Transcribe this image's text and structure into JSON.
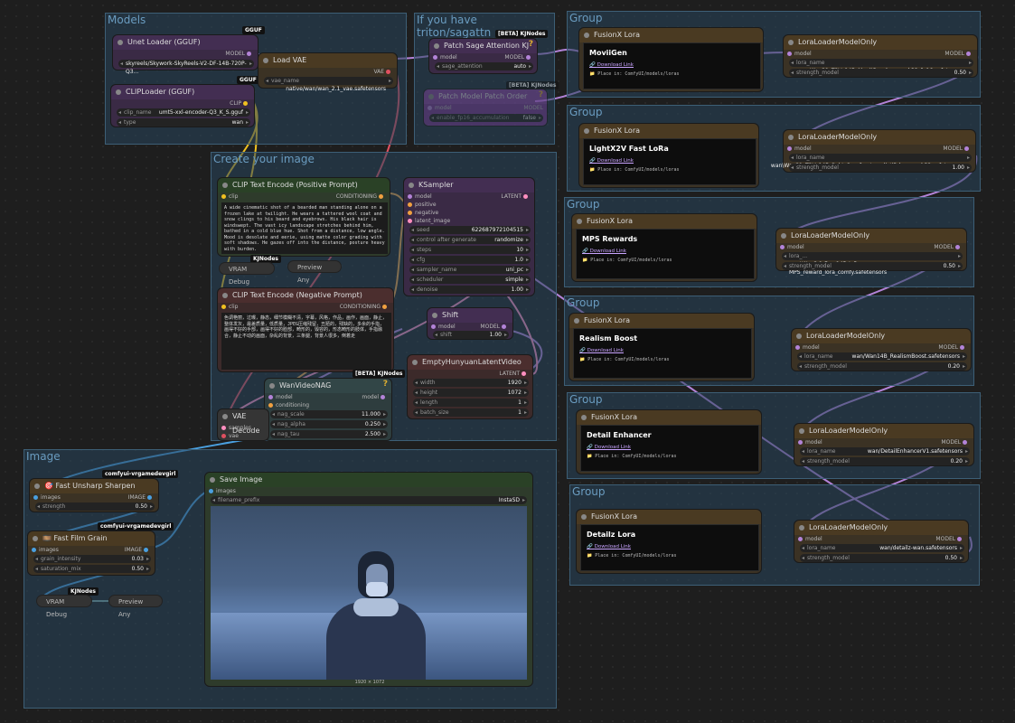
{
  "groups": {
    "models": "Models",
    "triton": "If you have triton/sagattn",
    "create": "Create your image",
    "image": "Image",
    "lora_groups": [
      "Group",
      "Group",
      "Group",
      "Group",
      "Group",
      "Group"
    ]
  },
  "tags": {
    "gguf": "GGUF",
    "kjnodes_beta": "[BETA] KJNodes",
    "kjnodes": "KJNodes",
    "author": "comfyui-vrgamedevgirl"
  },
  "unet_loader": {
    "title": "Unet Loader (GGUF)",
    "out": "MODEL",
    "value": "skyreels/Skywork-SkyReels-V2-DF-14B-720P-Q3..."
  },
  "clip_loader": {
    "title": "CLIPLoader (GGUF)",
    "out": "CLIP",
    "clip_name_label": "clip_name",
    "clip_name": "umt5-xxl-encoder-Q3_K_S.gguf",
    "type_label": "type",
    "type": "wan"
  },
  "load_vae": {
    "title": "Load VAE",
    "out": "VAE",
    "label": "vae_name",
    "value": "native/wan/wan_2.1_vae.safetensors"
  },
  "patch_sage": {
    "title": "Patch Sage Attention KJ",
    "in": "model",
    "out": "MODEL",
    "label": "sage_attention",
    "value": "auto"
  },
  "patch_fast": {
    "title": "Patch Model Patch Order",
    "in": "model",
    "out": "MODEL",
    "label": "enable_fp16_accumulation",
    "value": "false"
  },
  "clip_pos": {
    "title": "CLIP Text Encode (Positive Prompt)",
    "in": "clip",
    "out": "CONDITIONING",
    "text": "A wide cinematic shot of a bearded man standing alone on a frozen lake at twilight. He wears a tattered wool coat and snow clings to his beard and eyebrows. His black hair is windswept. The vast icy landscape stretches behind him, bathed in a cold blue hue. Shot from a distance, low angle. Mood is desolate and eerie, using matte color grading with soft shadows. He gazes off into the distance, posture heavy with burden."
  },
  "clip_neg": {
    "title": "CLIP Text Encode (Negative Prompt)",
    "in": "clip",
    "out": "CONDITIONING",
    "text": "色调艳丽，过曝，静态，细节模糊不清，字幕，风格，作品，画作，画面，静止，整体发灰，最差质量，低质量，JPEG压缩残留，丑陋的，残缺的，多余的手指，画得不好的手部，画得不好的脸部，畸形的，毁容的，形态畸形的肢体，手指融合，静止不动的画面，杂乱的背景，三条腿，背景人很多，倒着走"
  },
  "vram1": {
    "title": "VRAM Debug"
  },
  "preview1": {
    "title": "Preview Any"
  },
  "ksampler": {
    "title": "KSampler",
    "inputs": [
      "model",
      "positive",
      "negative",
      "latent_image"
    ],
    "out": "LATENT",
    "widgets": [
      [
        "seed",
        "622687972104515"
      ],
      [
        "control after generate",
        "randomize"
      ],
      [
        "steps",
        "10"
      ],
      [
        "cfg",
        "1.0"
      ],
      [
        "sampler_name",
        "uni_pc"
      ],
      [
        "scheduler",
        "simple"
      ],
      [
        "denoise",
        "1.00"
      ]
    ]
  },
  "shift": {
    "title": "Shift",
    "in": "model",
    "out": "MODEL",
    "label": "shift",
    "value": "1.00"
  },
  "empty_latent": {
    "title": "EmptyHunyuanLatentVideo",
    "out": "LATENT",
    "widgets": [
      [
        "width",
        "1920"
      ],
      [
        "height",
        "1072"
      ],
      [
        "length",
        "1"
      ],
      [
        "batch_size",
        "1"
      ]
    ]
  },
  "wan_nag": {
    "title": "WanVideoNAG",
    "inputs": [
      "model",
      "conditioning"
    ],
    "out": "model",
    "widgets": [
      [
        "nag_scale",
        "11.000"
      ],
      [
        "nag_alpha",
        "0.250"
      ],
      [
        "nag_tau",
        "2.500"
      ]
    ]
  },
  "vae_decode": {
    "title": "VAE Decode",
    "inputs": [
      "samples",
      "vae"
    ]
  },
  "unsharp": {
    "title": "🎯 Fast Unsharp Sharpen",
    "in": "images",
    "out": "IMAGE",
    "label": "strength",
    "value": "0.50"
  },
  "film_grain": {
    "title": "🎞️ Fast Film Grain",
    "in": "images",
    "out": "IMAGE",
    "widgets": [
      [
        "grain_intensity",
        "0.03"
      ],
      [
        "saturation_mix",
        "0.50"
      ]
    ]
  },
  "vram2": {
    "title": "VRAM Debug"
  },
  "preview2": {
    "title": "Preview Any"
  },
  "save_image": {
    "title": "Save Image",
    "in": "images",
    "label": "filename_prefix",
    "value": "InstaSD",
    "size": "1920 × 1072"
  },
  "loras": [
    {
      "note_head": "FusionX Lora",
      "note_title": "MoviiGen",
      "link": "Download Link",
      "path": "Place in: ComfyUI/models/loras",
      "loader": "LoraLoaderModelOnly",
      "lora_label": "lora_name",
      "lora_name": "Wan21_T2V_14B_MoviiGen_lora_rank32_fp16.safetensors",
      "strength_label": "strength_model",
      "strength": "0.50"
    },
    {
      "note_head": "FusionX Lora",
      "note_title": "LightX2V Fast LoRa",
      "link": "Download Link",
      "path": "Place in: ComfyUI/models/loras",
      "loader": "LoraLoaderModelOnly",
      "lora_label": "lora_name",
      "lora_name": "wan\\Wan21_T2V_14B_lightx2v_cfg_step_distill_lora_rank32.safetensors",
      "strength_label": "strength_model",
      "strength": "1.00"
    },
    {
      "note_head": "FusionX Lora",
      "note_title": "MPS Rewards",
      "link": "Download Link",
      "path": "Place in: ComfyUI/models/loras",
      "loader": "LoraLoaderModelOnly",
      "lora_label": "lora_...",
      "lora_name": "wan\\Wan2.1-Fun-14B-InP-MPS_reward_lora_comfy.safetensors",
      "strength_label": "strength_model",
      "strength": "0.50"
    },
    {
      "note_head": "FusionX Lora",
      "note_title": "Realism Boost",
      "link": "Download Link",
      "path": "Place in: ComfyUI/models/loras",
      "loader": "LoraLoaderModelOnly",
      "lora_label": "lora_name",
      "lora_name": "wan/Wan14B_RealismBoost.safetensors",
      "strength_label": "strength_model",
      "strength": "0.20"
    },
    {
      "note_head": "FusionX Lora",
      "note_title": "Detail Enhancer",
      "link": "Download Link",
      "path": "Place in: ComfyUI/models/loras",
      "loader": "LoraLoaderModelOnly",
      "lora_label": "lora_name",
      "lora_name": "wan/DetailEnhancerV1.safetensors",
      "strength_label": "strength_model",
      "strength": "0.20"
    },
    {
      "note_head": "FusionX Lora",
      "note_title": "Detailz Lora",
      "link": "Download Link",
      "path": "Place in: ComfyUI/models/loras",
      "loader": "LoraLoaderModelOnly",
      "lora_label": "lora_name",
      "lora_name": "wan/detailz-wan.safetensors",
      "strength_label": "strength_model",
      "strength": "0.50"
    }
  ],
  "lora_model_label": "model",
  "lora_out_label": "MODEL"
}
